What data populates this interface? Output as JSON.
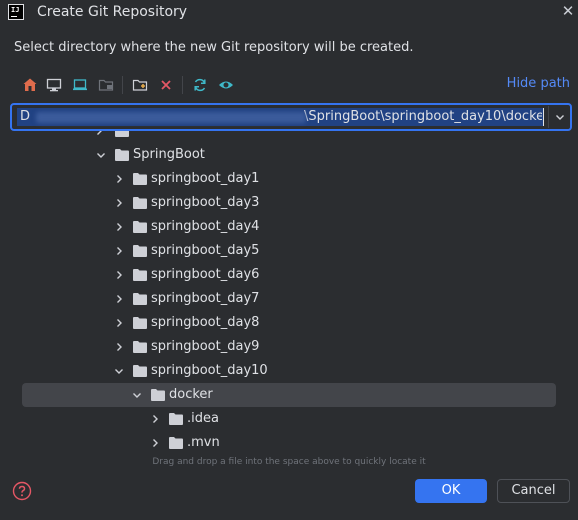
{
  "dialog": {
    "title": "Create Git Repository",
    "app_logo_text": "IJ",
    "description": "Select directory where the new Git repository will be created."
  },
  "toolbar": {
    "icons": [
      "home-icon",
      "desktop-icon",
      "project-icon",
      "module-icon",
      "new-folder-icon",
      "delete-icon",
      "refresh-icon",
      "show-hidden-icon"
    ],
    "hide_path_label": "Hide path"
  },
  "path_field": {
    "value_visible": "\\SpringBoot\\springboot_day10\\docker",
    "drive_letter": "D"
  },
  "tree": {
    "items": [
      {
        "label": "SpringBoot",
        "expanded": true
      },
      {
        "label": "springboot_day1",
        "expanded": false
      },
      {
        "label": "springboot_day3",
        "expanded": false
      },
      {
        "label": "springboot_day4",
        "expanded": false
      },
      {
        "label": "springboot_day5",
        "expanded": false
      },
      {
        "label": "springboot_day6",
        "expanded": false
      },
      {
        "label": "springboot_day7",
        "expanded": false
      },
      {
        "label": "springboot_day8",
        "expanded": false
      },
      {
        "label": "springboot_day9",
        "expanded": false
      },
      {
        "label": "springboot_day10",
        "expanded": true
      },
      {
        "label": "docker",
        "expanded": true,
        "selected": true
      },
      {
        "label": ".idea",
        "expanded": false
      },
      {
        "label": ".mvn",
        "expanded": false
      }
    ]
  },
  "hint": "Drag and drop a file into the space above to quickly locate it",
  "buttons": {
    "ok": "OK",
    "cancel": "Cancel"
  },
  "colors": {
    "accent": "#3574f0",
    "link": "#548af7",
    "background": "#2b2d30",
    "delete": "#e55765",
    "home": "#e06c4c",
    "refresh": "#3fb9c9"
  }
}
